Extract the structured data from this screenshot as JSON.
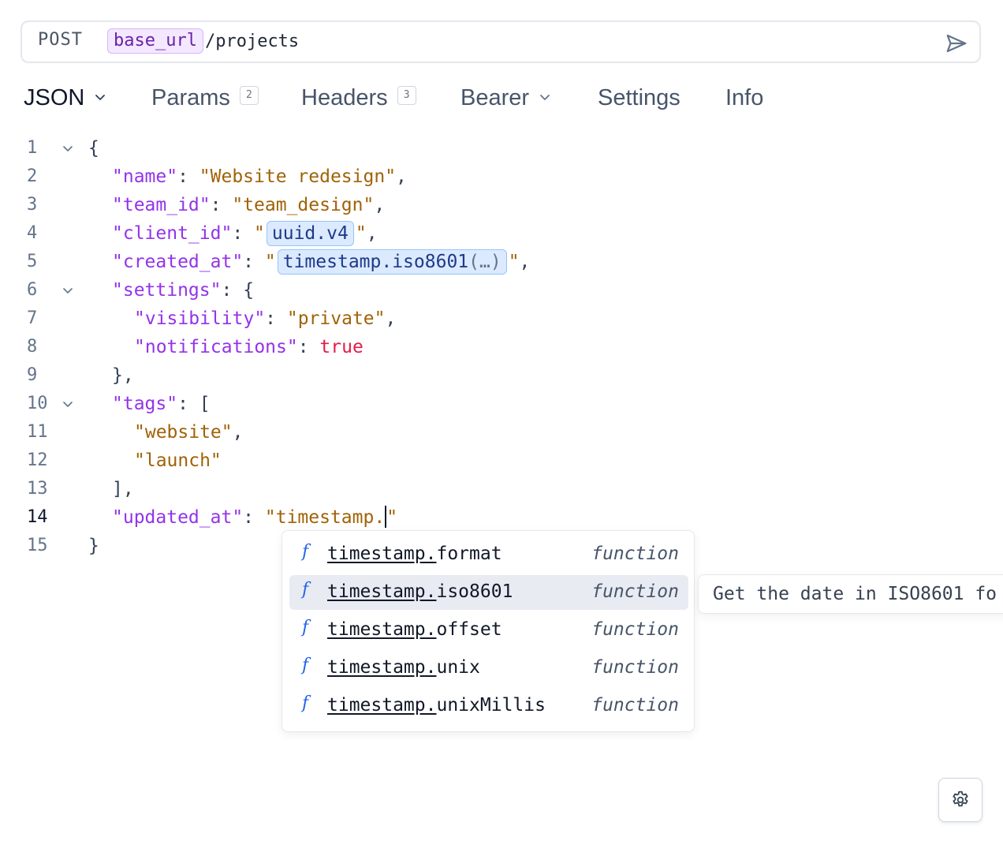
{
  "request": {
    "method": "POST",
    "url_variable": "base_url",
    "url_path": "/projects"
  },
  "tabs": [
    {
      "label": "JSON",
      "dropdown": true
    },
    {
      "label": "Params",
      "count": "2"
    },
    {
      "label": "Headers",
      "count": "3"
    },
    {
      "label": "Bearer",
      "dropdown": true
    },
    {
      "label": "Settings"
    },
    {
      "label": "Info"
    }
  ],
  "editor": {
    "line_numbers": [
      "1",
      "2",
      "3",
      "4",
      "5",
      "6",
      "7",
      "8",
      "9",
      "10",
      "11",
      "12",
      "13",
      "14",
      "15"
    ],
    "current_line": "14",
    "lines": {
      "l1": {
        "brace": "{"
      },
      "l2": {
        "key": "\"name\"",
        "colon": ": ",
        "value": "\"Website redesign\"",
        "comma": ","
      },
      "l3": {
        "key": "\"team_id\"",
        "colon": ": ",
        "value": "\"team_design\"",
        "comma": ","
      },
      "l4": {
        "key": "\"client_id\"",
        "colon": ": ",
        "quote_open": "\"",
        "tag": "uuid.v4",
        "quote_close": "\"",
        "comma": ","
      },
      "l5": {
        "key": "\"created_at\"",
        "colon": ": ",
        "quote_open": "\"",
        "tag": "timestamp.iso8601",
        "tag_args": "(…)",
        "quote_close": "\"",
        "comma": ","
      },
      "l6": {
        "key": "\"settings\"",
        "colon": ": ",
        "brace": "{"
      },
      "l7": {
        "key": "\"visibility\"",
        "colon": ": ",
        "value": "\"private\"",
        "comma": ","
      },
      "l8": {
        "key": "\"notifications\"",
        "colon": ": ",
        "value": "true"
      },
      "l9": {
        "brace": "},"
      },
      "l10": {
        "key": "\"tags\"",
        "colon": ": ",
        "brace": "["
      },
      "l11": {
        "value": "\"website\"",
        "comma": ","
      },
      "l12": {
        "value": "\"launch\""
      },
      "l13": {
        "brace": "],"
      },
      "l14": {
        "key": "\"updated_at\"",
        "colon": ": ",
        "value_before_caret": "\"timestamp.",
        "value_after_caret": "\""
      },
      "l15": {
        "brace": "}"
      }
    }
  },
  "autocomplete": {
    "prefix": "timestamp.",
    "items": [
      {
        "icon": "f",
        "suffix": "format",
        "kind": "function"
      },
      {
        "icon": "f",
        "suffix": "iso8601",
        "kind": "function",
        "selected": true
      },
      {
        "icon": "f",
        "suffix": "offset",
        "kind": "function"
      },
      {
        "icon": "f",
        "suffix": "unix",
        "kind": "function"
      },
      {
        "icon": "f",
        "suffix": "unixMillis",
        "kind": "function"
      }
    ],
    "doc": "Get the date in ISO8601 fo"
  },
  "colors": {
    "key": "#9333ea",
    "string": "#a16207",
    "boolean": "#e11d48",
    "variable_chip": "#f3e8ff",
    "template_chip": "#dbeafe",
    "selected_row": "#e8ebf2"
  },
  "icons": {
    "send": "send-icon",
    "dropdown": "chevron-down-icon",
    "fold": "chevron-down-icon",
    "settings": "gear-icon"
  }
}
